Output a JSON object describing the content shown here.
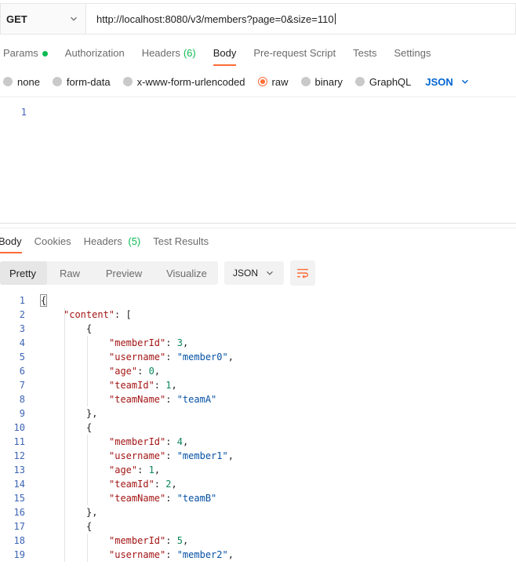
{
  "request": {
    "method": "GET",
    "url": "http://localhost:8080/v3/members?page=0&size=110"
  },
  "request_tabs": [
    {
      "label": "Params",
      "active": false,
      "indicator": "green-dot"
    },
    {
      "label": "Authorization",
      "active": false
    },
    {
      "label": "Headers",
      "count": "(6)",
      "active": false
    },
    {
      "label": "Body",
      "active": true
    },
    {
      "label": "Pre-request Script",
      "active": false
    },
    {
      "label": "Tests",
      "active": false
    },
    {
      "label": "Settings",
      "active": false
    }
  ],
  "body_types": [
    {
      "label": "none",
      "selected": false
    },
    {
      "label": "form-data",
      "selected": false
    },
    {
      "label": "x-www-form-urlencoded",
      "selected": false
    },
    {
      "label": "raw",
      "selected": true
    },
    {
      "label": "binary",
      "selected": false
    },
    {
      "label": "GraphQL",
      "selected": false
    }
  ],
  "body_format": "JSON",
  "request_body_lines": [
    "1"
  ],
  "response_tabs": [
    {
      "label": "Body",
      "active": true
    },
    {
      "label": "Cookies",
      "active": false
    },
    {
      "label": "Headers",
      "count": "(5)",
      "active": false
    },
    {
      "label": "Test Results",
      "active": false
    }
  ],
  "view_modes": [
    {
      "label": "Pretty",
      "active": true
    },
    {
      "label": "Raw",
      "active": false
    },
    {
      "label": "Preview",
      "active": false
    },
    {
      "label": "Visualize",
      "active": false
    }
  ],
  "response_format": "JSON",
  "response_lines": [
    {
      "n": "1",
      "indent": 0,
      "tokens": [
        [
          "p",
          "{"
        ]
      ]
    },
    {
      "n": "2",
      "indent": 1,
      "tokens": [
        [
          "k",
          "\"content\""
        ],
        [
          "p",
          ": ["
        ]
      ]
    },
    {
      "n": "3",
      "indent": 2,
      "tokens": [
        [
          "p",
          "{"
        ]
      ]
    },
    {
      "n": "4",
      "indent": 3,
      "tokens": [
        [
          "k",
          "\"memberId\""
        ],
        [
          "p",
          ": "
        ],
        [
          "n",
          "3"
        ],
        [
          "p",
          ","
        ]
      ]
    },
    {
      "n": "5",
      "indent": 3,
      "tokens": [
        [
          "k",
          "\"username\""
        ],
        [
          "p",
          ": "
        ],
        [
          "s",
          "\"member0\""
        ],
        [
          "p",
          ","
        ]
      ]
    },
    {
      "n": "6",
      "indent": 3,
      "tokens": [
        [
          "k",
          "\"age\""
        ],
        [
          "p",
          ": "
        ],
        [
          "n",
          "0"
        ],
        [
          "p",
          ","
        ]
      ]
    },
    {
      "n": "7",
      "indent": 3,
      "tokens": [
        [
          "k",
          "\"teamId\""
        ],
        [
          "p",
          ": "
        ],
        [
          "n",
          "1"
        ],
        [
          "p",
          ","
        ]
      ]
    },
    {
      "n": "8",
      "indent": 3,
      "tokens": [
        [
          "k",
          "\"teamName\""
        ],
        [
          "p",
          ": "
        ],
        [
          "s",
          "\"teamA\""
        ]
      ]
    },
    {
      "n": "9",
      "indent": 2,
      "tokens": [
        [
          "p",
          "},"
        ]
      ]
    },
    {
      "n": "10",
      "indent": 2,
      "tokens": [
        [
          "p",
          "{"
        ]
      ]
    },
    {
      "n": "11",
      "indent": 3,
      "tokens": [
        [
          "k",
          "\"memberId\""
        ],
        [
          "p",
          ": "
        ],
        [
          "n",
          "4"
        ],
        [
          "p",
          ","
        ]
      ]
    },
    {
      "n": "12",
      "indent": 3,
      "tokens": [
        [
          "k",
          "\"username\""
        ],
        [
          "p",
          ": "
        ],
        [
          "s",
          "\"member1\""
        ],
        [
          "p",
          ","
        ]
      ]
    },
    {
      "n": "13",
      "indent": 3,
      "tokens": [
        [
          "k",
          "\"age\""
        ],
        [
          "p",
          ": "
        ],
        [
          "n",
          "1"
        ],
        [
          "p",
          ","
        ]
      ]
    },
    {
      "n": "14",
      "indent": 3,
      "tokens": [
        [
          "k",
          "\"teamId\""
        ],
        [
          "p",
          ": "
        ],
        [
          "n",
          "2"
        ],
        [
          "p",
          ","
        ]
      ]
    },
    {
      "n": "15",
      "indent": 3,
      "tokens": [
        [
          "k",
          "\"teamName\""
        ],
        [
          "p",
          ": "
        ],
        [
          "s",
          "\"teamB\""
        ]
      ]
    },
    {
      "n": "16",
      "indent": 2,
      "tokens": [
        [
          "p",
          "},"
        ]
      ]
    },
    {
      "n": "17",
      "indent": 2,
      "tokens": [
        [
          "p",
          "{"
        ]
      ]
    },
    {
      "n": "18",
      "indent": 3,
      "tokens": [
        [
          "k",
          "\"memberId\""
        ],
        [
          "p",
          ": "
        ],
        [
          "n",
          "5"
        ],
        [
          "p",
          ","
        ]
      ]
    },
    {
      "n": "19",
      "indent": 3,
      "tokens": [
        [
          "k",
          "\"username\""
        ],
        [
          "p",
          ": "
        ],
        [
          "s",
          "\"member2\""
        ],
        [
          "p",
          ","
        ]
      ]
    }
  ],
  "colors": {
    "accent": "#ff6c37",
    "success": "#0cbb52",
    "link": "#0265d2"
  }
}
